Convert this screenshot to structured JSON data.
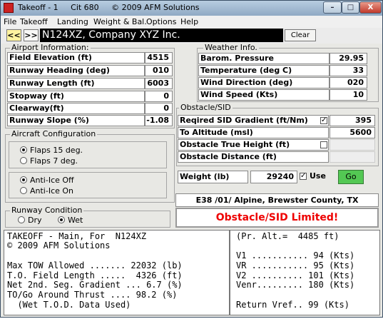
{
  "window": {
    "title": "Takeoff - 1     Cit 680     © 2009 AFM Solutions",
    "min_glyph": "–",
    "max_glyph": "□",
    "close_glyph": "X"
  },
  "menu": [
    "File",
    "Takeoff",
    "Landing",
    "Weight & Bal.",
    "Options",
    "Help"
  ],
  "toolbar": {
    "prev_label": "<<",
    "next_label": ">>",
    "tail_text": "N124XZ, Company XYZ Inc.",
    "clear_label": "Clear"
  },
  "airport": {
    "legend": "Airport Information:",
    "rows": [
      {
        "label": "Field Elevation (ft)",
        "value": "4515"
      },
      {
        "label": "Runway Heading (deg)",
        "value": "010"
      },
      {
        "label": "Runway Length (ft)",
        "value": "6003"
      },
      {
        "label": "Stopway (ft)",
        "value": "0"
      },
      {
        "label": "Clearway(ft)",
        "value": "0"
      },
      {
        "label": "Runway Slope (%)",
        "value": "-1.08"
      }
    ]
  },
  "weather": {
    "legend": "Weather Info.",
    "rows": [
      {
        "label": "Barom. Pressure",
        "value": "29.95"
      },
      {
        "label": "Temperature (deg C)",
        "value": "33"
      },
      {
        "label": "Wind Direction (deg)",
        "value": "020"
      },
      {
        "label": "Wind Speed (Kts)",
        "value": "10"
      }
    ]
  },
  "obstacle": {
    "legend": "Obstacle/SID",
    "sid_label": "Reqired SID Gradient (ft/Nm)",
    "sid_checked": true,
    "sid_value": "395",
    "altitude_label": "To Altitude (msl)",
    "altitude_value": "5600",
    "true_height_label": "Obstacle True Height (ft)",
    "true_height_checked": false,
    "distance_label": "Obstacle Distance (ft)"
  },
  "weight": {
    "label": "Weight (lb)",
    "value": "29240",
    "use_checked": true,
    "use_label": "Use",
    "go_label": "Go"
  },
  "config": {
    "legend": "Aircraft Configuration",
    "flaps": [
      {
        "label": "Flaps 15 deg.",
        "selected": true
      },
      {
        "label": "Flaps  7 deg.",
        "selected": false
      }
    ],
    "anti_ice": [
      {
        "label": "Anti-Ice Off",
        "selected": true
      },
      {
        "label": "Anti-Ice On",
        "selected": false
      }
    ]
  },
  "runway_condition": {
    "legend": "Runway Condition",
    "options": [
      {
        "label": "Dry",
        "selected": false
      },
      {
        "label": "Wet",
        "selected": true
      }
    ]
  },
  "location": "E38 /01/ Alpine, Brewster County, TX",
  "warning": "Obstacle/SID Limited!",
  "results_left": [
    "TAKEOFF - Main, For  N124XZ",
    "© 2009 AFM Solutions",
    "",
    "Max TOW Allowed ....... 22032 (lb)",
    "T.O. Field Length .....  4326 (ft)",
    "Net 2nd. Seg. Gradient ... 6.7 (%)",
    "TO/Go Around Thrust .... 98.2 (%)",
    "  (Wet T.O.D. Data Used)"
  ],
  "results_right": [
    "(Pr. Alt.=  4485 ft)",
    "",
    "V1 ........... 94 (Kts)",
    "VR ........... 95 (Kts)",
    "V2 .......... 101 (Kts)",
    "Venr......... 180 (Kts)",
    "",
    "Return Vref.. 99 (Kts)"
  ],
  "colors": {
    "go_button": "#53c853",
    "warning_text": "#e00000",
    "tail_background": "#000000",
    "close_button": "#c0392b"
  }
}
